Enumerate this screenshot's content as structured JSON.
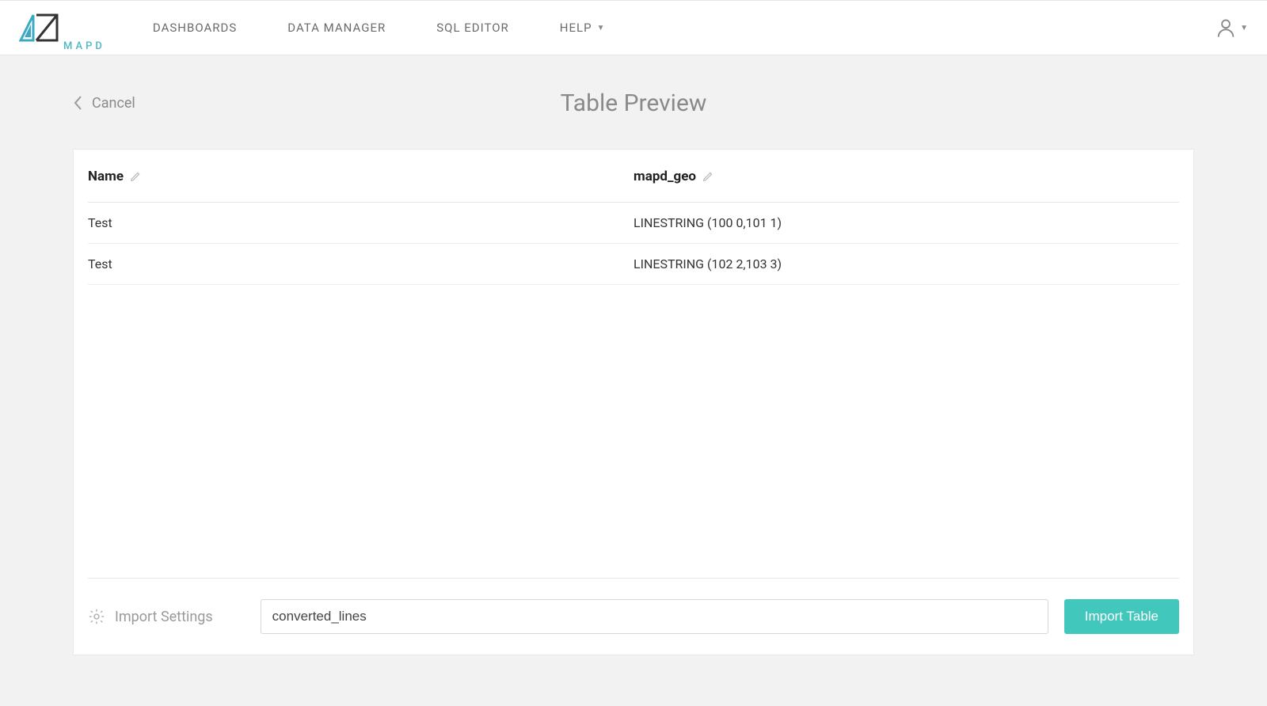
{
  "brand": "MAPD",
  "nav": {
    "dashboards": "DASHBOARDS",
    "data_manager": "DATA MANAGER",
    "sql_editor": "SQL EDITOR",
    "help": "HELP"
  },
  "cancel_label": "Cancel",
  "page_title": "Table Preview",
  "columns": [
    {
      "label": "Name"
    },
    {
      "label": "mapd_geo"
    }
  ],
  "rows": [
    {
      "name": "Test",
      "geo": "LINESTRING (100 0,101 1)"
    },
    {
      "name": "Test",
      "geo": "LINESTRING (102 2,103 3)"
    }
  ],
  "footer": {
    "import_settings_label": "Import Settings",
    "table_name_value": "converted_lines",
    "import_button_label": "Import Table"
  }
}
